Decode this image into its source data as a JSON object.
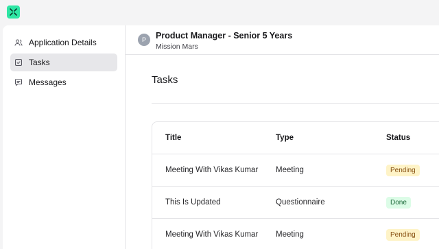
{
  "app": {
    "logo_icon": "puzzle-logo-icon",
    "accent": "#2ee6a4"
  },
  "sidebar": {
    "items": [
      {
        "label": "Application Details",
        "icon": "users-icon",
        "active": false
      },
      {
        "label": "Tasks",
        "icon": "checkbox-icon",
        "active": true
      },
      {
        "label": "Messages",
        "icon": "chat-icon",
        "active": false
      }
    ]
  },
  "header": {
    "avatar_letter": "P",
    "title": "Product Manager - Senior 5 Years",
    "subtitle": "Mission Mars"
  },
  "tasks": {
    "section_title": "Tasks",
    "columns": [
      "Title",
      "Type",
      "Status"
    ],
    "rows": [
      {
        "title": "Meeting With Vikas Kumar",
        "type": "Meeting",
        "status": "Pending"
      },
      {
        "title": "This Is Updated",
        "type": "Questionnaire",
        "status": "Done"
      },
      {
        "title": "Meeting With Vikas Kumar",
        "type": "Meeting",
        "status": "Pending"
      }
    ]
  },
  "colors": {
    "pending_bg": "#fef3c7",
    "done_bg": "#dcfce7"
  }
}
